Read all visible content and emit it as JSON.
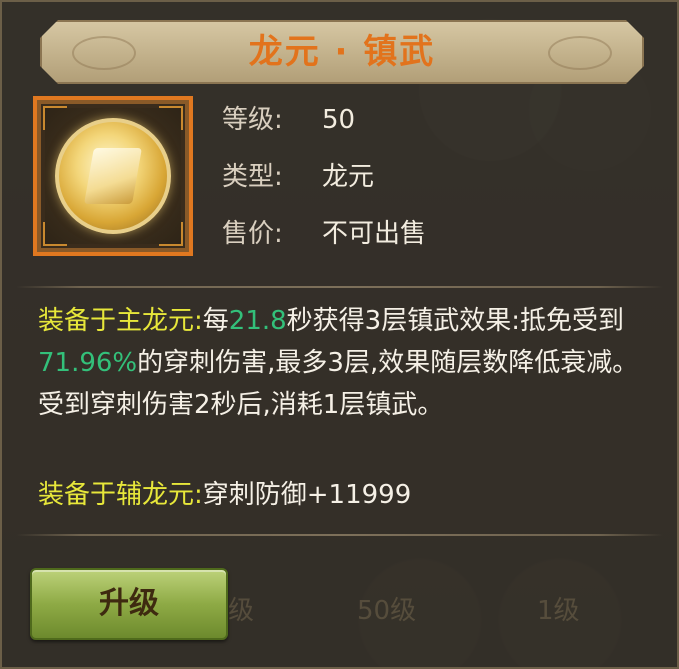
{
  "title": "龙元 · 镇武",
  "item": {
    "icon": "dragon-orb-icon",
    "level_label": "等级:",
    "level_value": "50",
    "type_label": "类型:",
    "type_value": "龙元",
    "price_label": "售价:",
    "price_value": "不可出售"
  },
  "description": {
    "main_label": "装备于主龙元:",
    "t1": "每",
    "interval": "21.8",
    "t2": "秒获得3层镇武效果:抵免受到",
    "percent": "71.96%",
    "t3": "的穿刺伤害,最多3层,效果随层数降低衰减。受到穿刺伤害2秒后,消耗1层镇武。",
    "secondary_label": "装备于辅龙元:",
    "secondary_effect": "穿刺防御+11999"
  },
  "background": {
    "ghost_1": "级",
    "ghost_2": "50级",
    "ghost_3": "1级"
  },
  "upgrade_button": "升级",
  "colors": {
    "title": "#e2731c",
    "highlight_label": "#e7e73a",
    "number": "#33c07a",
    "button": "#8eaa45"
  }
}
